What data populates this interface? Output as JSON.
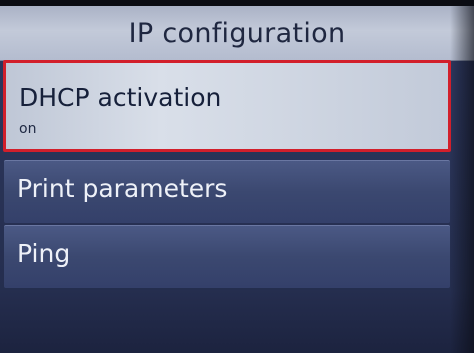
{
  "header": {
    "title": "IP configuration"
  },
  "menu": {
    "items": [
      {
        "label": "DHCP activation",
        "value": "on",
        "selected": true
      },
      {
        "label": "Print parameters"
      },
      {
        "label": "Ping"
      }
    ]
  },
  "colors": {
    "selection_border": "#d21f2b",
    "header_background": "#c3cad9",
    "item_background": "#3b4870"
  }
}
